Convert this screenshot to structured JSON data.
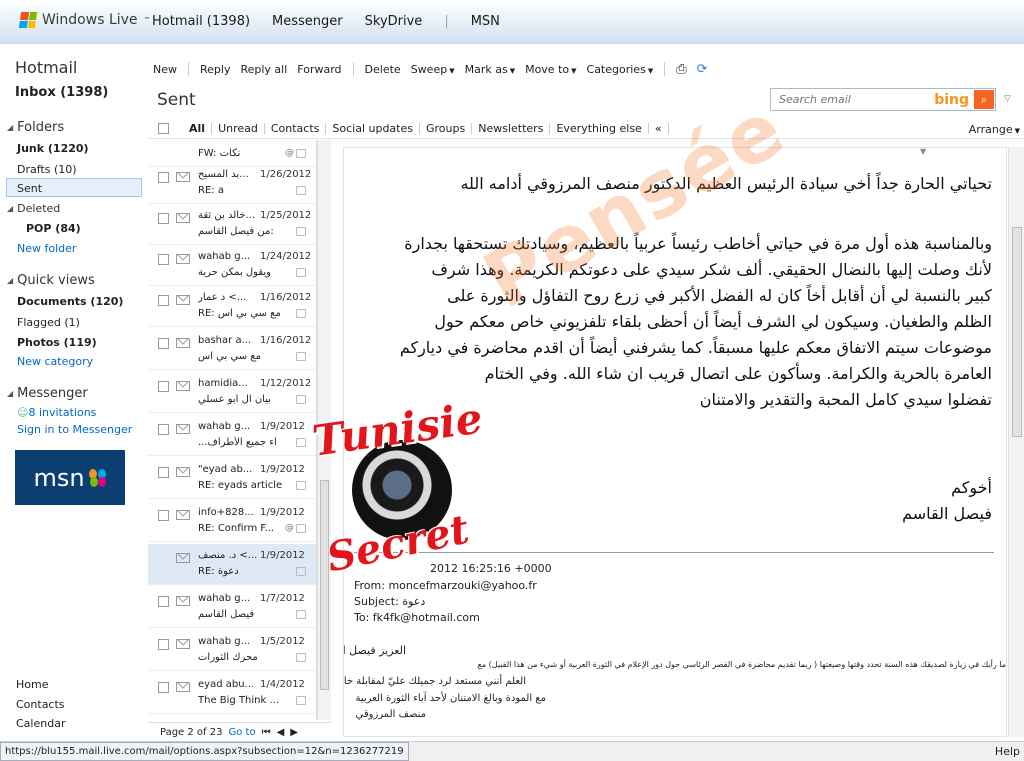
{
  "topbar": {
    "brand": "Windows Live",
    "brand_tm": "™",
    "nav": [
      "Hotmail (1398)",
      "Messenger",
      "SkyDrive",
      "|",
      "MSN"
    ]
  },
  "sidebar": {
    "title": "Hotmail",
    "inbox": "Inbox (1398)",
    "folders_header": "Folders",
    "junk": "Junk (1220)",
    "drafts": "Drafts (10)",
    "sent": "Sent",
    "deleted": "Deleted",
    "pop": "POP (84)",
    "new_folder": "New folder",
    "quick_views_header": "Quick views",
    "documents": "Documents (120)",
    "flagged": "Flagged (1)",
    "photos": "Photos (119)",
    "new_category": "New category",
    "messenger_header": "Messenger",
    "invitations": "8 invitations",
    "sign_in": "Sign in to Messenger",
    "msn_logo": "msn",
    "home": "Home",
    "contacts": "Contacts",
    "calendar": "Calendar"
  },
  "toolbar": {
    "new": "New",
    "reply": "Reply",
    "reply_all": "Reply all",
    "forward": "Forward",
    "delete": "Delete",
    "sweep": "Sweep",
    "mark_as": "Mark as",
    "move_to": "Move to",
    "categories": "Categories"
  },
  "folder_title": "Sent",
  "search": {
    "placeholder": "Search email",
    "bing": "bing"
  },
  "filters": [
    "All",
    "Unread",
    "Contacts",
    "Social updates",
    "Groups",
    "Newsletters",
    "Everything else"
  ],
  "filters_more": "«",
  "arrange": "Arrange",
  "messages": [
    {
      "from": "",
      "date": "",
      "subject": "FW: نكات",
      "attach": "@"
    },
    {
      "from": "بد المسيح...",
      "date": "1/26/2012",
      "subject": "RE: a",
      "attach": ""
    },
    {
      "from": "خالد بن ثقة...",
      "date": "1/25/2012",
      "subject": "من فيصل القاسم:",
      "attach": ""
    },
    {
      "from": "wahab g...",
      "date": "1/24/2012",
      "subject": "ويقول بمكن حرية",
      "attach": ""
    },
    {
      "from": "د عمار <...",
      "date": "1/16/2012",
      "subject": "RE: مع سي بي اس",
      "attach": ""
    },
    {
      "from": "bashar a...",
      "date": "1/16/2012",
      "subject": "مع سي بي اس",
      "attach": ""
    },
    {
      "from": "hamidia...",
      "date": "1/12/2012",
      "subject": "بيان آل ابو عسلي",
      "attach": ""
    },
    {
      "from": "wahab g...",
      "date": "1/9/2012",
      "subject": "...اء جميع الأطراف",
      "attach": ""
    },
    {
      "from": "\"eyad ab...",
      "date": "1/9/2012",
      "subject": "RE: eyads article",
      "attach": ""
    },
    {
      "from": "info+828...",
      "date": "1/9/2012",
      "subject": "RE: Confirm F...",
      "attach": "@"
    },
    {
      "from": "د. منصف <...",
      "date": "1/9/2012",
      "subject": "RE: دعوة",
      "attach": ""
    },
    {
      "from": "wahab g...",
      "date": "1/7/2012",
      "subject": "فيصل القاسم",
      "attach": ""
    },
    {
      "from": "wahab g...",
      "date": "1/5/2012",
      "subject": "محرك الثورات",
      "attach": ""
    },
    {
      "from": "eyad abu...",
      "date": "1/4/2012",
      "subject": "The Big Think ...",
      "attach": ""
    }
  ],
  "pager": {
    "label": "Page 2 of 23",
    "go_to": "Go to"
  },
  "email": {
    "greeting": "تحياتي الحارة جداً أخي سيادة الرئيس العظيم الدكتور منصف المرزوقي أدامه الله",
    "body": [
      "وبالمناسبة هذه أول مرة في حياتي أخاطب رئيساً عربياً بالعظيم، وسيادتك تستحقها بجدارة",
      "لأنك وصلت إليها بالنضال الحقيقي. ألف شكر سيدي على دعوتكم الكريمة. وهذا شرف",
      "كبير بالنسبة لي أن أقابل أخاً كان له الفضل الأكبر في زرع روح التفاؤل والثورة على",
      "الظلم والطغيان. وسيكون لي الشرف أيضاً أن أحظى بلقاء تلفزيوني خاص معكم حول",
      "موضوعات سيتم الاتفاق معكم عليها مسبقاً. كما يشرفني أيضاً أن اقدم محاضرة في دياركم",
      "العامرة بالحرية والكرامة. وسأكون على اتصال قريب ان شاء الله. وفي الختام",
      "تفضلوا سيدي كامل المحبة والتقدير والامتنان"
    ],
    "closing": "أخوكم",
    "signature": "فيصل القاسم",
    "quoted_date": "2012 16:25:16 +0000",
    "quoted_from": "From: moncefmarzouki@yahoo.fr",
    "quoted_subject": "Subject: دعوة",
    "quoted_to": "To: fk4fk@hotmail.com",
    "quoted_salutation": "العزيز فيصل القاسم",
    "quoted_lines": [
      "ما رأيك في زيارة لصديقك  هذه السنة تحدد وقتها وصيغتها ( ربما تقديم محاضرة في القصر الرئاسي حول دور الإعلام في الثورة العربية أو شيء من هذا القبيل) مع",
      "العلم أنني مستعد لرد جميلك عليّ لمقابلة خاصة أو أي صيغة تقترحها",
      "مع المودة وبالغ الامتنان لأحد آباء الثورة العربية",
      "منصف المرزوقي"
    ]
  },
  "watermark": {
    "line1": "Tunisie",
    "line2": "Secret",
    "band": "Pensée"
  },
  "status": {
    "url": "https://blu155.mail.live.com/mail/options.aspx?subsection=12&n=1236277219",
    "right_fragment": "rs",
    "help": "Help"
  },
  "colors": {
    "accent_blue": "#0066cc",
    "selected_row": "#dfe9f6",
    "bing_orange": "#f26522",
    "msn_bg": "#0b3f72",
    "watermark_red": "#e3151a"
  }
}
